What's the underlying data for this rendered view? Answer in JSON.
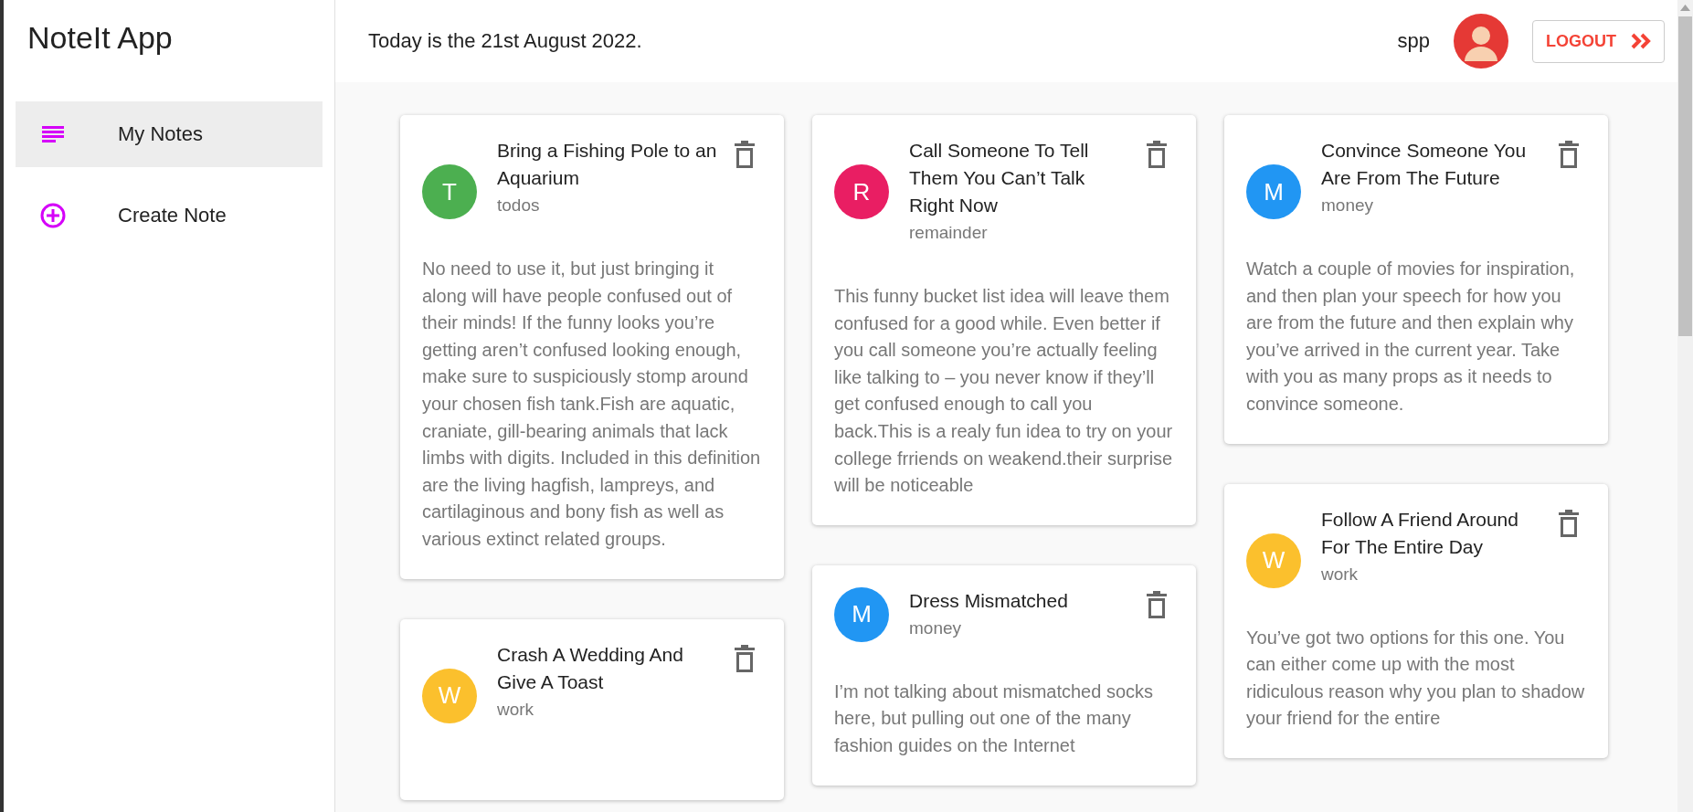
{
  "app_title": "NoteIt App",
  "sidebar": {
    "items": [
      {
        "label": "My Notes",
        "kind": "list",
        "selected": true
      },
      {
        "label": "Create Note",
        "kind": "create",
        "selected": false
      }
    ]
  },
  "header": {
    "date_text": "Today is the 21st August 2022.",
    "username": "spp",
    "logout_label": "LOGOUT"
  },
  "columns": [
    {
      "notes": [
        {
          "initial": "T",
          "color": "#4caf50",
          "title": "Bring a Fishing Pole to an Aquarium",
          "category": "todos",
          "body": "No need to use it, but just bringing it along will have people confused out of their minds! If the funny looks you’re getting aren’t confused looking enough, make sure to suspiciously stomp around your chosen fish tank.Fish are aquatic, craniate, gill-bearing animals that lack limbs with digits. Included in this definition are the living hagfish, lampreys, and cartilaginous and bony fish as well as various extinct related groups."
        },
        {
          "initial": "W",
          "color": "#fbc02d",
          "title": "Crash A Wedding And Give A Toast",
          "category": "work"
        }
      ]
    },
    {
      "notes": [
        {
          "initial": "R",
          "color": "#e91e63",
          "title": "Call Someone To Tell Them You Can’t Talk Right Now",
          "category": "remainder",
          "body": "This funny bucket list idea will leave them confused for a good while. Even better if you call someone you’re actually feeling like talking to – you never know if they’ll get confused enough to call you back.This is a realy fun idea to try on your college frriends on weakend.their surprise will be noticeable"
        },
        {
          "initial": "M",
          "color": "#2196f3",
          "title": "Dress Mismatched",
          "category": "money",
          "body": "I’m not talking about mismatched socks here, but pulling out one of the many fashion guides on the Internet"
        }
      ]
    },
    {
      "notes": [
        {
          "initial": "M",
          "color": "#2196f3",
          "title": "Convince Someone You Are From The Future",
          "category": "money",
          "body": "Watch a couple of movies for inspiration, and then plan your speech for how you are from the future and then explain why you’ve arrived in the current year. Take with you as many props as it needs to convince someone."
        },
        {
          "initial": "W",
          "color": "#fbc02d",
          "title": "Follow A Friend Around For The Entire Day",
          "category": "work",
          "body": "You’ve got two options for this one. You can either come up with the most ridiculous reason why you plan to shadow your friend for the entire"
        }
      ]
    }
  ]
}
